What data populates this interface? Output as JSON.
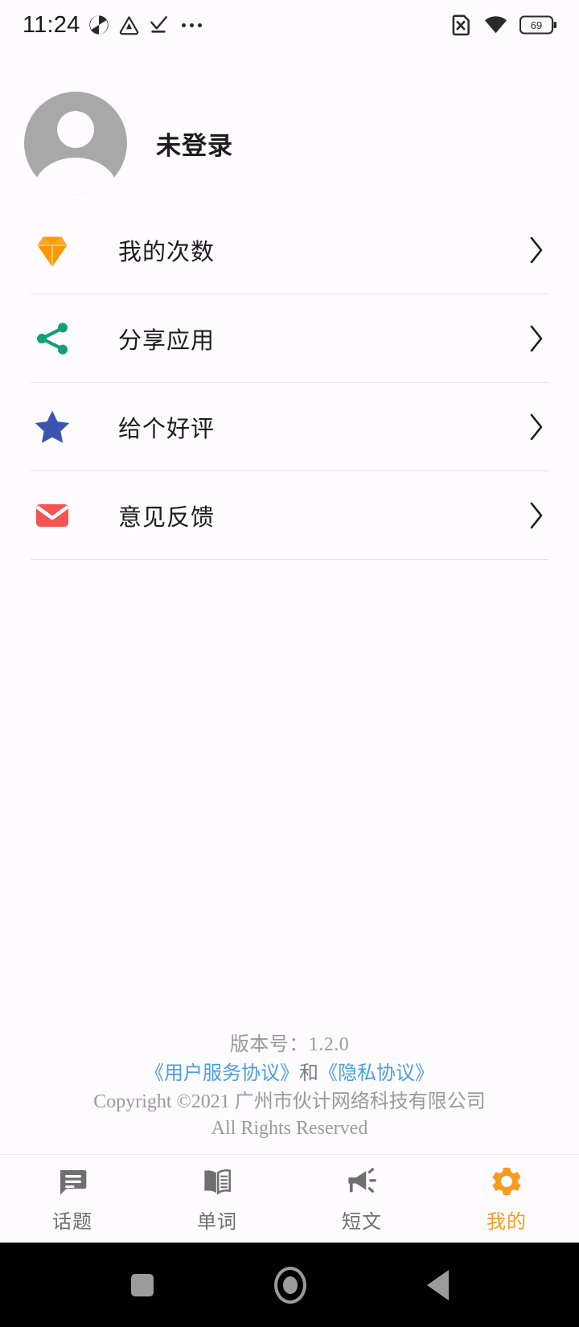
{
  "status_bar": {
    "time": "11:24",
    "icons_left": [
      "app-badge-icon",
      "triangle-alert-icon",
      "download-complete-icon",
      "more-dots-icon"
    ],
    "icons_right": [
      "no-sim-icon",
      "wifi-icon",
      "battery-icon"
    ],
    "battery_level": "69"
  },
  "profile": {
    "nickname": "未登录",
    "avatar_icon": "default-user-avatar"
  },
  "menu": {
    "items": [
      {
        "label": "我的次数",
        "icon": "diamond-icon",
        "icon_color": "#FB9A00",
        "chevron": "›"
      },
      {
        "label": "分享应用",
        "icon": "share-icon",
        "icon_color": "#11A07B",
        "chevron": "›"
      },
      {
        "label": "给个好评",
        "icon": "star-icon",
        "icon_color": "#3B55B0",
        "chevron": "›"
      },
      {
        "label": "意见反馈",
        "icon": "envelope-icon",
        "icon_color": "#F6544F",
        "chevron": "›"
      }
    ]
  },
  "footer": {
    "version": "版本号：1.2.0",
    "service_agreement": "《用户服务协议》",
    "conjunction": "和",
    "privacy_agreement": "《隐私协议》",
    "copyright_line1": "Copyright ©2021 广州市伙计网络科技有限公司",
    "copyright_line2": "All Rights Reserved",
    "link_color": "#4A9FE0"
  },
  "tab_bar": {
    "active_color": "#F79B1E",
    "inactive_color": "#6F6F6F",
    "tabs": [
      {
        "label": "话题",
        "icon": "chat-bubble-icon",
        "active": false
      },
      {
        "label": "单词",
        "icon": "open-book-icon",
        "active": false
      },
      {
        "label": "短文",
        "icon": "megaphone-icon",
        "active": false
      },
      {
        "label": "我的",
        "icon": "gear-icon",
        "active": true
      }
    ]
  },
  "android_nav": {
    "buttons": [
      "recents-square-button",
      "home-circle-button",
      "back-triangle-button"
    ]
  }
}
